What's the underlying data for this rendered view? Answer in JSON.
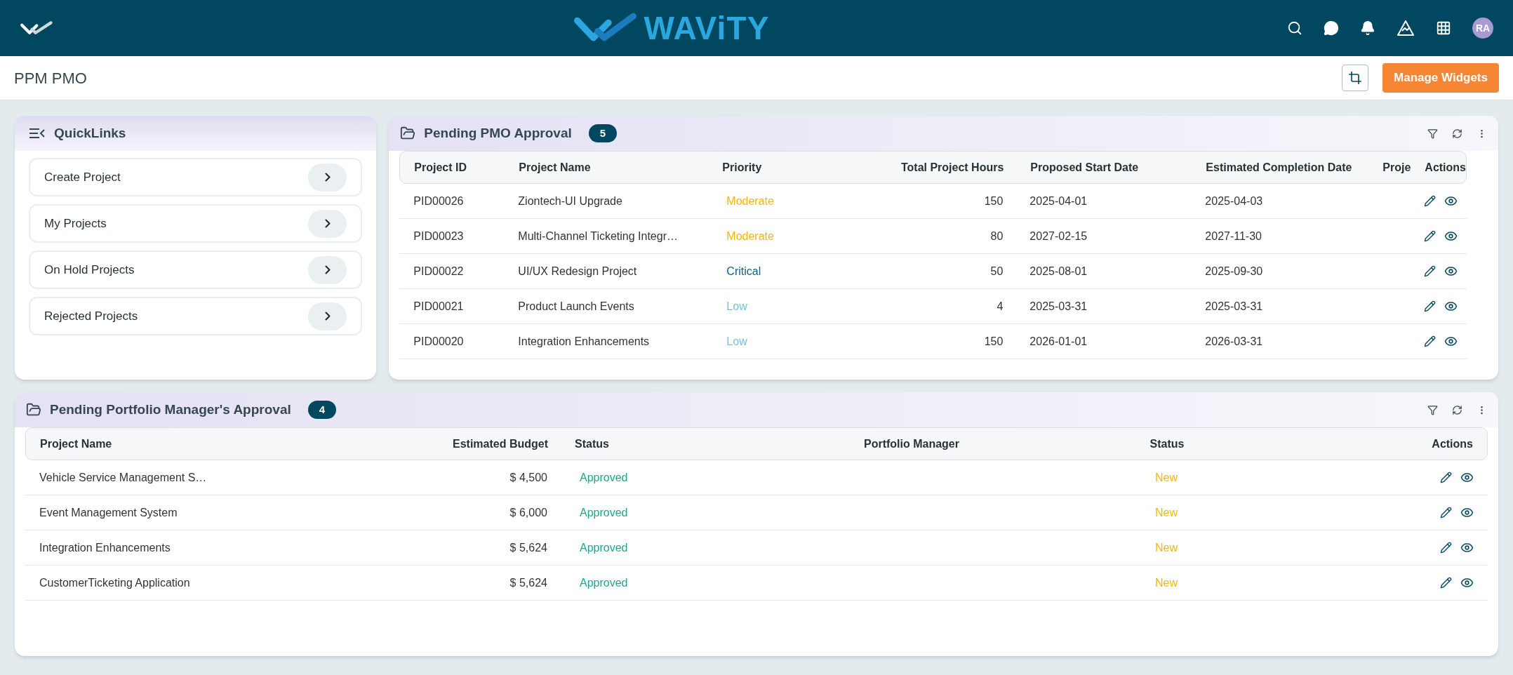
{
  "header": {
    "brand": "WAViTY",
    "avatar": "RA"
  },
  "page": {
    "title": "PPM PMO",
    "manage_button": "Manage Widgets"
  },
  "quicklinks": {
    "title": "QuickLinks",
    "items": [
      "Create Project",
      "My Projects",
      "On Hold Projects",
      "Rejected Projects"
    ]
  },
  "pmo": {
    "title": "Pending PMO Approval",
    "count": "5",
    "columns": [
      "Project ID",
      "Project Name",
      "Priority",
      "Total Project Hours",
      "Proposed Start Date",
      "Estimated Completion Date",
      "Proje",
      "Actions"
    ],
    "rows": [
      {
        "id": "PID00026",
        "name": "Ziontech-UI Upgrade",
        "priority": "Moderate",
        "color": "#f5b800",
        "hours": "150",
        "start": "2025-04-01",
        "end": "2025-04-03"
      },
      {
        "id": "PID00023",
        "name": "Multi-Channel Ticketing Integr…",
        "priority": "Moderate",
        "color": "#f5b800",
        "hours": "80",
        "start": "2027-02-15",
        "end": "2027-11-30"
      },
      {
        "id": "PID00022",
        "name": "UI/UX Redesign Project",
        "priority": "Critical",
        "color": "#0b5f86",
        "hours": "50",
        "start": "2025-08-01",
        "end": "2025-09-30"
      },
      {
        "id": "PID00021",
        "name": "Product Launch Events",
        "priority": "Low",
        "color": "#6cc5e0",
        "hours": "4",
        "start": "2025-03-31",
        "end": "2025-03-31"
      },
      {
        "id": "PID00020",
        "name": "Integration Enhancements",
        "priority": "Low",
        "color": "#6cc5e0",
        "hours": "150",
        "start": "2026-01-01",
        "end": "2026-03-31"
      }
    ]
  },
  "portfolio": {
    "title": "Pending Portfolio Manager's Approval",
    "count": "4",
    "columns": [
      "Project Name",
      "Estimated Budget",
      "Status",
      "Portfolio Manager",
      "Status",
      "Actions"
    ],
    "rows": [
      {
        "name": "Vehicle Service Management S…",
        "budget": "$ 4,500",
        "status": {
          "text": "Approved",
          "color": "#1aa88a"
        },
        "pm_status": {
          "text": "New",
          "color": "#f5b800"
        }
      },
      {
        "name": "Event Management System",
        "budget": "$ 6,000",
        "status": {
          "text": "Approved",
          "color": "#1aa88a"
        },
        "pm_status": {
          "text": "New",
          "color": "#f5b800"
        }
      },
      {
        "name": "Integration Enhancements",
        "budget": "$ 5,624",
        "status": {
          "text": "Approved",
          "color": "#1aa88a"
        },
        "pm_status": {
          "text": "New",
          "color": "#f5b800"
        }
      },
      {
        "name": "CustomerTicketing Application",
        "budget": "$ 5,624",
        "status": {
          "text": "Approved",
          "color": "#1aa88a"
        },
        "pm_status": {
          "text": "New",
          "color": "#f5b800"
        }
      }
    ]
  }
}
